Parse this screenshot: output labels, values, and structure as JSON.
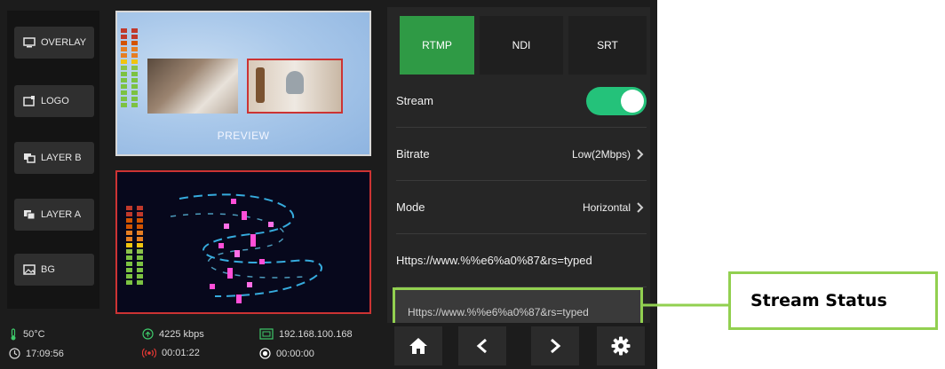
{
  "sidebar": {
    "buttons": [
      {
        "label": "OVERLAY",
        "icon": "monitor-icon"
      },
      {
        "label": "LOGO",
        "icon": "screen-add-icon"
      },
      {
        "label": "LAYER B",
        "icon": "layers-icon"
      },
      {
        "label": "LAYER A",
        "icon": "layers-icon"
      },
      {
        "label": "BG",
        "icon": "image-icon"
      }
    ]
  },
  "preview": {
    "label": "PREVIEW"
  },
  "status_bar": {
    "temperature": "50°C",
    "clock": "17:09:56",
    "bitrate": "4225 kbps",
    "stream_time": "00:01:22",
    "ip": "192.168.100.168",
    "record_time": "00:00:00"
  },
  "tabs": [
    {
      "label": "RTMP",
      "active": true
    },
    {
      "label": "NDI",
      "active": false
    },
    {
      "label": "SRT",
      "active": false
    }
  ],
  "settings": {
    "stream_label": "Stream",
    "stream_on": true,
    "bitrate_label": "Bitrate",
    "bitrate_value": "Low(2Mbps)",
    "mode_label": "Mode",
    "mode_value": "Horizontal",
    "url": "Https://www.%%e6%a0%87&rs=typed",
    "url_partial": "Https://www.%%e6%a0%87&rs=typed"
  },
  "callout": {
    "label": "Stream Status"
  },
  "colors": {
    "accent_green": "#2f9a45",
    "toggle_green": "#24c27a",
    "callout_border": "#92d050",
    "program_border": "#cc3333"
  }
}
